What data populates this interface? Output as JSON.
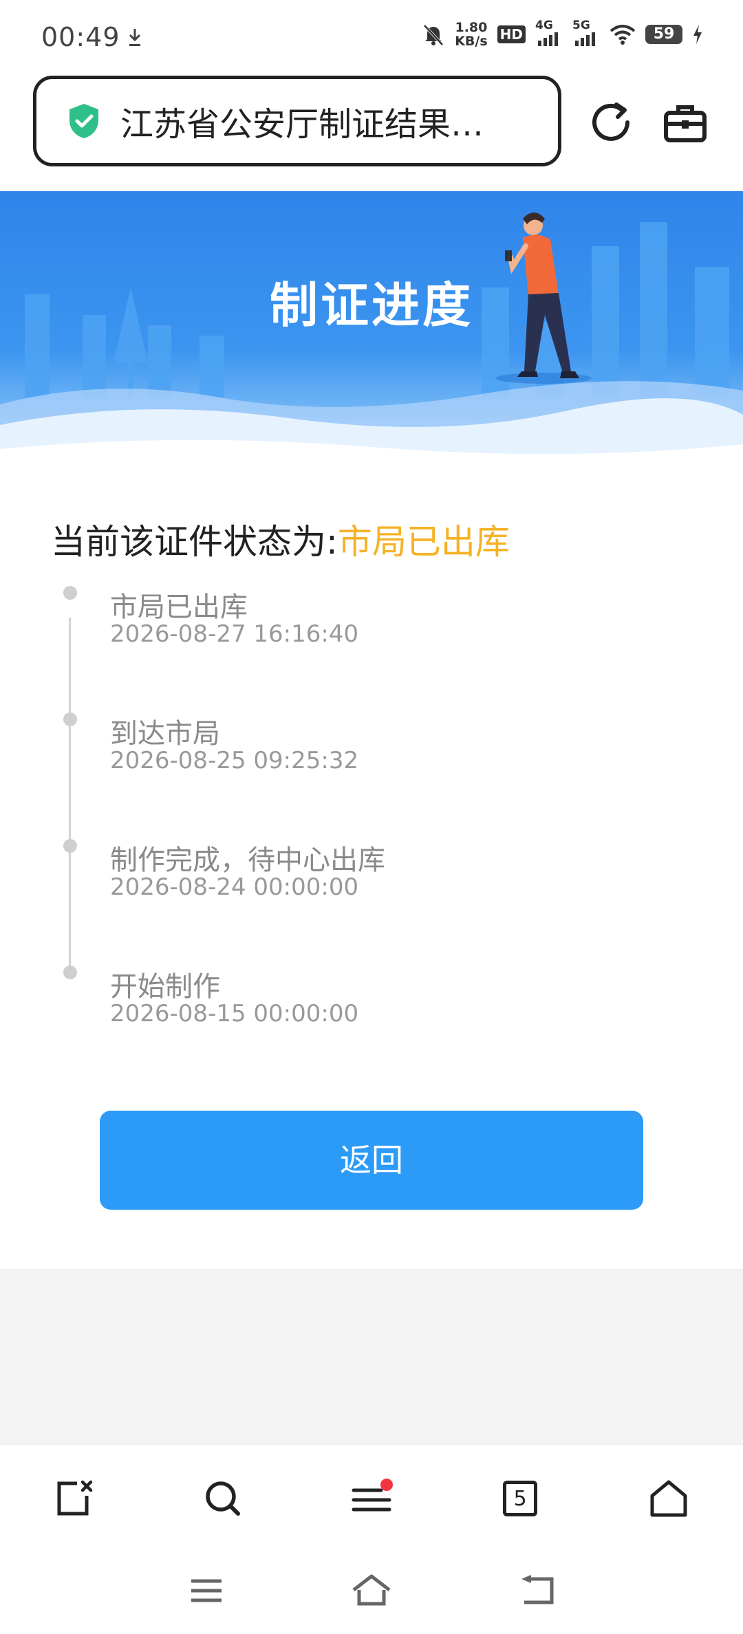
{
  "status_bar": {
    "time": "00:49",
    "net_speed_value": "1.80",
    "net_speed_unit": "KB/s",
    "hd_label": "HD",
    "sim1_label": "4G",
    "sim2_label": "5G",
    "battery": "59"
  },
  "address_bar": {
    "page_title": "江苏省公安厅制证结果…"
  },
  "banner": {
    "title": "制证进度"
  },
  "status": {
    "label": "当前该证件状态为:",
    "value": "市局已出库",
    "value_color": "#f6b225"
  },
  "timeline": [
    {
      "title": "市局已出库",
      "time": "2026-08-27 16:16:40"
    },
    {
      "title": "到达市局",
      "time": "2026-08-25 09:25:32"
    },
    {
      "title": "制作完成，待中心出库",
      "time": "2026-08-24 00:00:00"
    },
    {
      "title": "开始制作",
      "time": "2026-08-15 00:00:00"
    }
  ],
  "return_button": {
    "label": "返回",
    "color": "#2b9bf7"
  },
  "bottom_toolbar": {
    "tab_count": "5",
    "icons": [
      "close-tab-icon",
      "search-icon",
      "menu-icon",
      "tabs-icon",
      "home-icon"
    ]
  },
  "system_nav": {
    "icons": [
      "recents-icon",
      "home-icon",
      "back-icon"
    ]
  }
}
